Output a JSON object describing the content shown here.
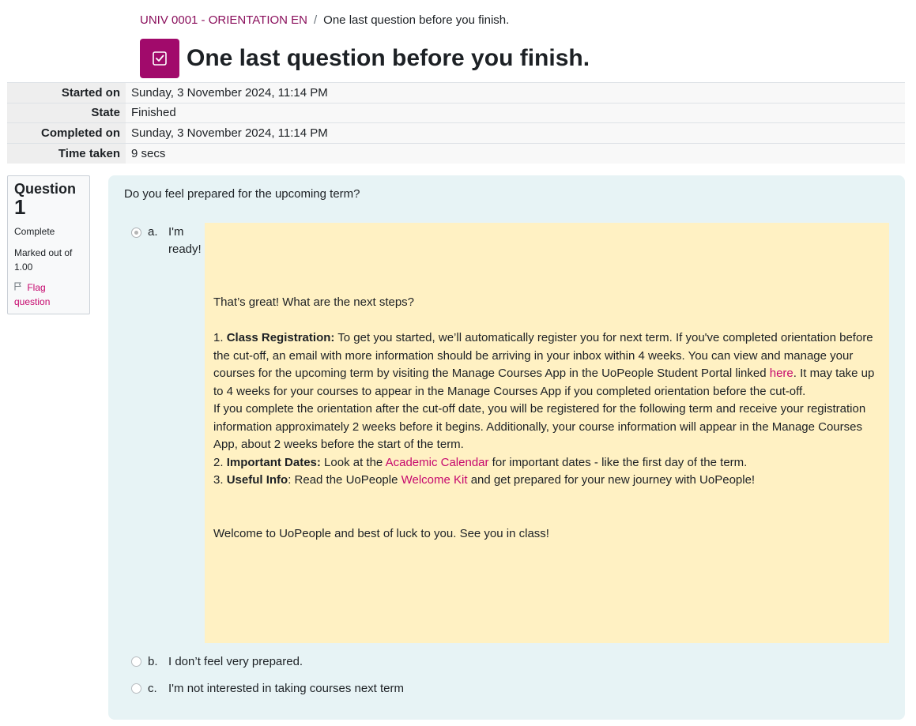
{
  "breadcrumb": {
    "course": "UNIV 0001 - ORIENTATION EN",
    "separator": "/",
    "current": "One last question before you finish."
  },
  "page_title": "One last question before you finish.",
  "summary": {
    "started_label": "Started on",
    "started_value": "Sunday, 3 November 2024, 11:14 PM",
    "state_label": "State",
    "state_value": "Finished",
    "completed_label": "Completed on",
    "completed_value": "Sunday, 3 November 2024, 11:14 PM",
    "time_label": "Time taken",
    "time_value": "9 secs"
  },
  "question_info": {
    "label": "Question",
    "number": "1",
    "state": "Complete",
    "grade_line1": "Marked out of",
    "grade_line2": "1.00",
    "flag_line1": "Flag",
    "flag_line2": "question"
  },
  "question": {
    "text": "Do you feel prepared for the upcoming term?",
    "options": [
      {
        "letter": "a.",
        "line1": "I'm",
        "line2": "ready!",
        "selected": true
      },
      {
        "letter": "b.",
        "text": "I don’t feel very prepared.",
        "selected": false
      },
      {
        "letter": "c.",
        "text": "I'm not interested in taking courses next term",
        "selected": false
      }
    ]
  },
  "feedback": {
    "intro": "That’s great! What are the next steps?",
    "p1_num": "1. ",
    "p1_bold": "Class Registration:",
    "p1_text": " To get you started, we’ll automatically register you for next term. If you've completed orientation before the cut-off, an email with more information should be arriving in your inbox within 4 weeks. You can view and manage your courses for the upcoming term by visiting the Manage Courses App in the UoPeople Student Portal linked ",
    "p1_link": "here",
    "p1_text2": ". It may take up to 4 weeks for your courses to appear in the Manage Courses App if you completed orientation before the cut-off.",
    "p1b": "If you complete the orientation after the cut-off date, you will be registered for the following term and receive your registration information approximately 2 weeks before it begins. Additionally, your course information will appear in the Manage Courses App, about 2 weeks before the start of the term.",
    "p2_num": "2. ",
    "p2_bold": "Important Dates:",
    "p2_text": " Look at the ",
    "p2_link": "Academic Calendar",
    "p2_text2": " for important dates - like the first day of the term.",
    "p3_num": "3. ",
    "p3_bold": "Useful Info",
    "p3_text": ": Read the UoPeople ",
    "p3_link": "Welcome Kit",
    "p3_text2": " and get prepared for your new journey with UoPeople!",
    "closing": "Welcome to UoPeople and best of luck to you. See you in class!"
  },
  "colors": {
    "link": "#8a0f5c",
    "accent": "#a10a6b",
    "feedback_bg": "#fff1c3",
    "question_bg": "#e7f3f5"
  },
  "icons": {
    "quiz": "checkbox-icon",
    "flag": "flag-icon"
  }
}
